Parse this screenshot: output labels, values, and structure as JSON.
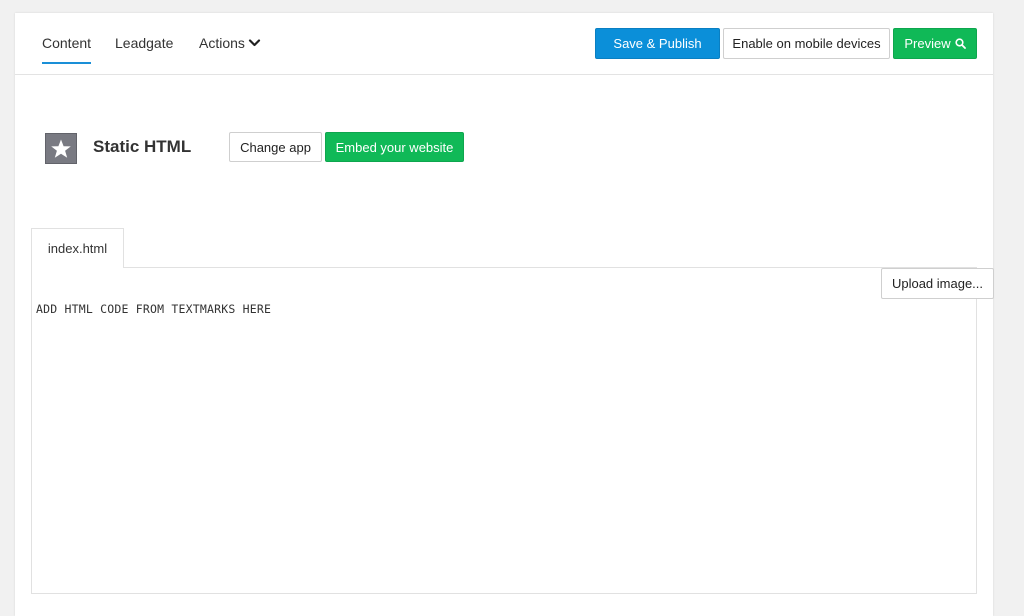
{
  "tabs": [
    {
      "label": "Content",
      "active": true
    },
    {
      "label": "Leadgate",
      "active": false
    },
    {
      "label": "Actions",
      "active": false
    }
  ],
  "toolbar": {
    "save_label": "Save & Publish",
    "mobile_label": "Enable on mobile devices",
    "preview_label": "Preview"
  },
  "app": {
    "icon": "star-icon",
    "title": "Static HTML",
    "change_label": "Change app",
    "embed_label": "Embed your website"
  },
  "editor": {
    "file_tab": "index.html",
    "upload_label": "Upload image...",
    "content": "ADD HTML CODE FROM TEXTMARKS HERE"
  },
  "colors": {
    "accent_blue": "#0b8fd9",
    "accent_green": "#10b957",
    "tab_underline": "#1a8fd7"
  }
}
